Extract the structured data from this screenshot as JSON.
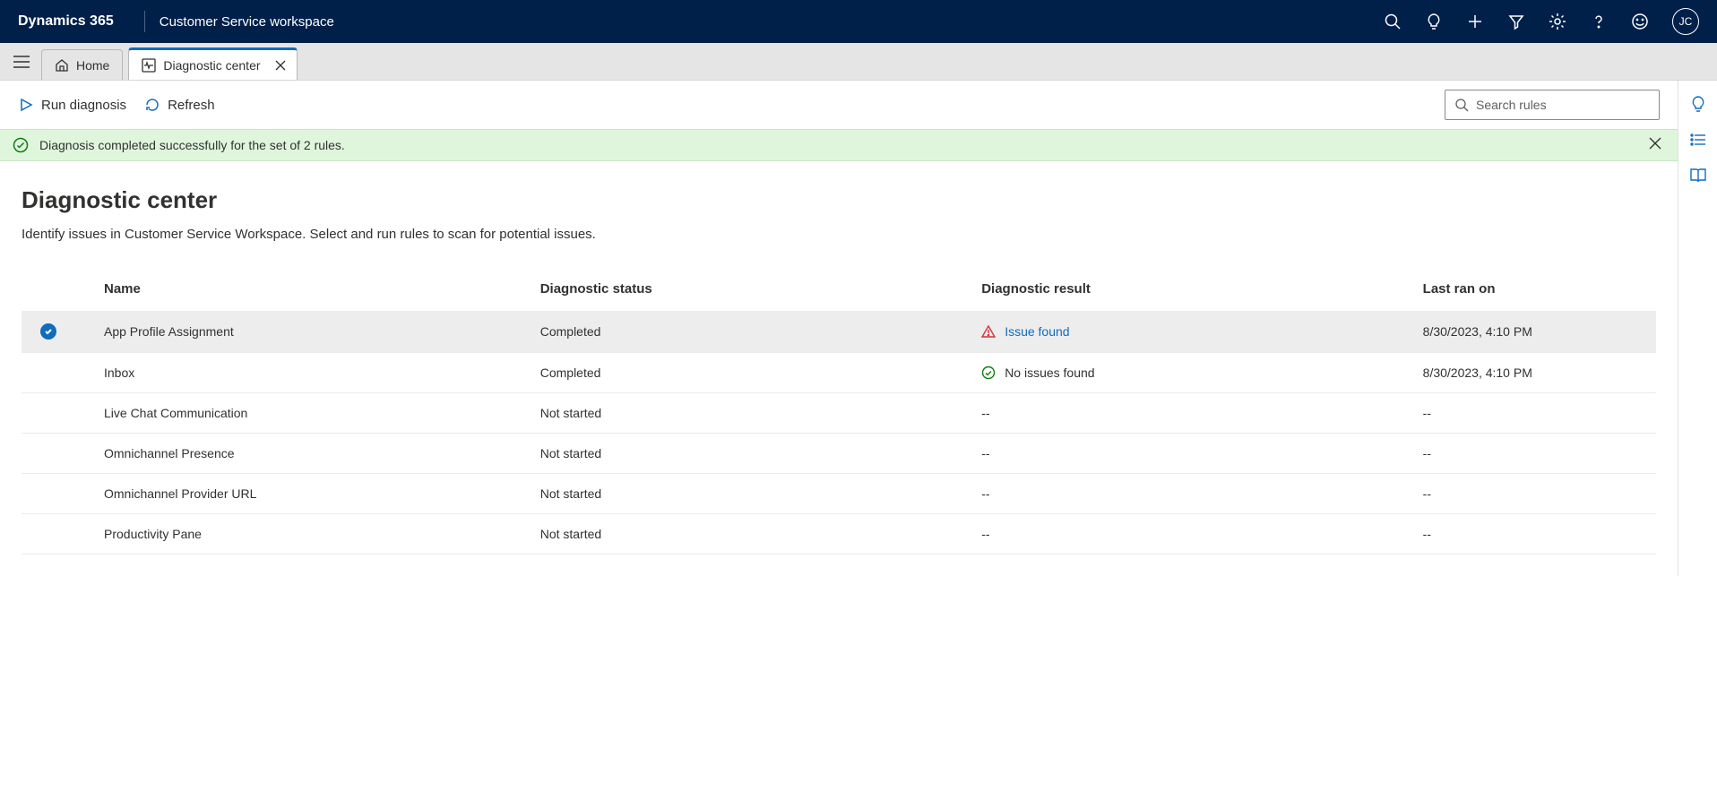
{
  "topbar": {
    "brand": "Dynamics 365",
    "workspace": "Customer Service workspace",
    "avatar_initials": "JC"
  },
  "tabs": {
    "home_label": "Home",
    "active_label": "Diagnostic center"
  },
  "cmdbar": {
    "run_label": "Run diagnosis",
    "refresh_label": "Refresh",
    "search_placeholder": "Search rules"
  },
  "banner": {
    "message": "Diagnosis completed successfully for the set of 2 rules."
  },
  "page": {
    "title": "Diagnostic center",
    "description": "Identify issues in Customer Service Workspace. Select and run rules to scan for potential issues."
  },
  "table": {
    "headers": {
      "name": "Name",
      "status": "Diagnostic status",
      "result": "Diagnostic result",
      "last_ran": "Last ran on"
    },
    "rows": [
      {
        "selected": true,
        "name": "App Profile Assignment",
        "status": "Completed",
        "result_type": "issue",
        "result_text": "Issue found",
        "last_ran": "8/30/2023, 4:10 PM"
      },
      {
        "selected": false,
        "name": "Inbox",
        "status": "Completed",
        "result_type": "ok",
        "result_text": "No issues found",
        "last_ran": "8/30/2023, 4:10 PM"
      },
      {
        "selected": false,
        "name": "Live Chat Communication",
        "status": "Not started",
        "result_type": "none",
        "result_text": "--",
        "last_ran": "--"
      },
      {
        "selected": false,
        "name": "Omnichannel Presence",
        "status": "Not started",
        "result_type": "none",
        "result_text": "--",
        "last_ran": "--"
      },
      {
        "selected": false,
        "name": "Omnichannel Provider URL",
        "status": "Not started",
        "result_type": "none",
        "result_text": "--",
        "last_ran": "--"
      },
      {
        "selected": false,
        "name": "Productivity Pane",
        "status": "Not started",
        "result_type": "none",
        "result_text": "--",
        "last_ran": "--"
      }
    ]
  }
}
